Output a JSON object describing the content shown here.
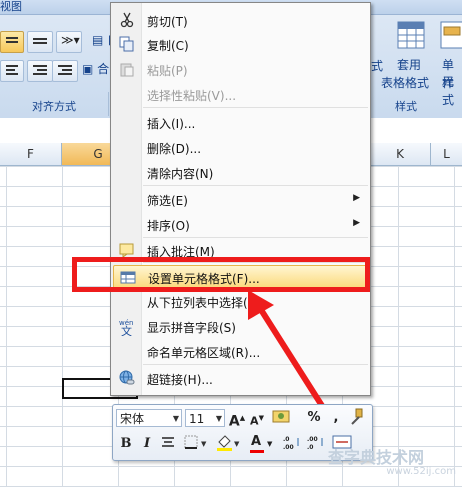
{
  "ribbon": {
    "top_tab_fragment": "视图",
    "group_alignment_label": "对齐方式",
    "group_styles_label": "样式",
    "wrap_fragment": "自",
    "merge_fragment": "合",
    "styles_fragment": "式",
    "table_format_label_1": "套用",
    "table_format_label_2": "表格格式",
    "cell_style_label_1": "单元",
    "cell_style_label_2": "样式"
  },
  "columns": [
    "F",
    "G",
    "K",
    "L"
  ],
  "context_menu": {
    "items": [
      {
        "label": "剪切(T)",
        "icon": "scissors-icon",
        "disabled": false
      },
      {
        "label": "复制(C)",
        "icon": "copy-icon",
        "disabled": false
      },
      {
        "label": "粘贴(P)",
        "icon": "paste-icon",
        "disabled": true
      },
      {
        "label": "选择性粘贴(V)...",
        "icon": "",
        "disabled": true
      },
      {
        "label": "插入(I)...",
        "icon": "",
        "disabled": false
      },
      {
        "label": "删除(D)...",
        "icon": "",
        "disabled": false
      },
      {
        "label": "清除内容(N)",
        "icon": "",
        "disabled": false
      },
      {
        "label": "筛选(E)",
        "icon": "",
        "disabled": false,
        "submenu": true
      },
      {
        "label": "排序(O)",
        "icon": "",
        "disabled": false,
        "submenu": true
      },
      {
        "label": "插入批注(M)",
        "icon": "comment-icon",
        "disabled": false
      },
      {
        "label": "设置单元格格式(F)...",
        "icon": "format-cells-icon",
        "disabled": false,
        "highlighted": true
      },
      {
        "label": "从下拉列表中选择(K)...",
        "icon": "",
        "disabled": false
      },
      {
        "label": "显示拼音字段(S)",
        "icon": "phonetic-icon",
        "disabled": false
      },
      {
        "label": "命名单元格区域(R)...",
        "icon": "",
        "disabled": false
      },
      {
        "label": "超链接(H)...",
        "icon": "hyperlink-icon",
        "disabled": false
      }
    ]
  },
  "mini_toolbar": {
    "font_name": "宋体",
    "font_size": "11",
    "percent": "%",
    "comma": ",",
    "bold": "B",
    "italic": "I",
    "font_color_letter": "A"
  },
  "watermark": {
    "text": "查字典技术网",
    "url": "www.52ij.com"
  },
  "colors": {
    "highlight_box": "#ee1c1c",
    "selected_column": "#f1b957",
    "ribbon_bg": "#dfe9f5"
  }
}
